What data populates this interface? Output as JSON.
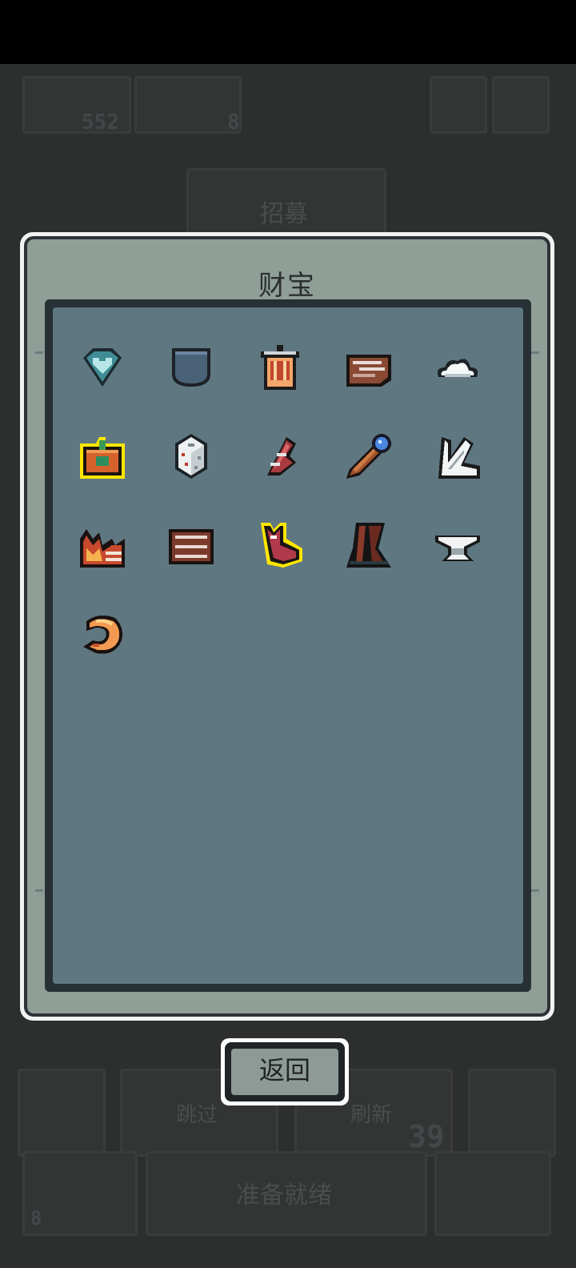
{
  "background_ui": {
    "top_left_count": "552",
    "top_second_count": "8",
    "recruit_tab": "招募",
    "skip_button": "跳过",
    "refresh_button": "刷新",
    "refresh_cost": "39",
    "bottom_left_count": "8",
    "bottom_center_text": "准备就绪"
  },
  "modal": {
    "title": "财宝",
    "back_button": "返回",
    "items": [
      {
        "name": "heart-gem-icon"
      },
      {
        "name": "shield-pocket-icon"
      },
      {
        "name": "lantern-jar-icon"
      },
      {
        "name": "wooden-plank-icon"
      },
      {
        "name": "cloud-icon"
      },
      {
        "name": "pumpkin-chest-icon",
        "highlighted": true
      },
      {
        "name": "white-dice-icon"
      },
      {
        "name": "red-feather-icon"
      },
      {
        "name": "magic-staff-icon"
      },
      {
        "name": "white-claw-icon"
      },
      {
        "name": "fire-ruins-icon"
      },
      {
        "name": "wooden-crate-icon"
      },
      {
        "name": "red-boot-icon",
        "highlighted": true
      },
      {
        "name": "broken-tree-icon"
      },
      {
        "name": "anvil-icon"
      },
      {
        "name": "shrimp-icon"
      }
    ]
  },
  "colors": {
    "panel": "#5f7780",
    "frame": "#8f9e96",
    "highlight": "#ffe600"
  }
}
